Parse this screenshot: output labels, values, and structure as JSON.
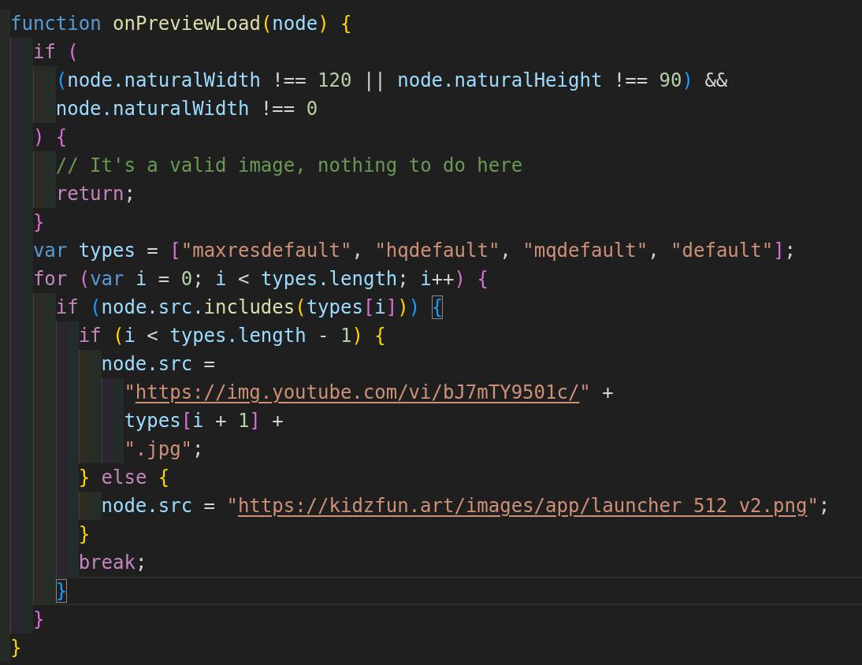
{
  "editor": {
    "lines": [
      {
        "current": false,
        "tokens": [
          {
            "kind": "kw",
            "text": "function "
          },
          {
            "kind": "fn",
            "text": "onPreviewLoad"
          },
          {
            "kind": "b1",
            "text": "("
          },
          {
            "kind": "var",
            "text": "node"
          },
          {
            "kind": "b1",
            "text": ")"
          },
          {
            "kind": "b1",
            "text": " {"
          }
        ],
        "children": [
          {
            "current": false,
            "tokens": [
              {
                "kind": "ctrl",
                "text": "if "
              },
              {
                "kind": "b2",
                "text": "("
              }
            ],
            "children": [
              {
                "current": false,
                "tokens": [
                  {
                    "kind": "b3",
                    "text": "("
                  },
                  {
                    "kind": "var",
                    "text": "node.naturalWidth"
                  },
                  {
                    "kind": "punc",
                    "text": " !== "
                  },
                  {
                    "kind": "num",
                    "text": "120"
                  },
                  {
                    "kind": "punc",
                    "text": " || "
                  },
                  {
                    "kind": "var",
                    "text": "node.naturalHeight"
                  },
                  {
                    "kind": "punc",
                    "text": " !== "
                  },
                  {
                    "kind": "num",
                    "text": "90"
                  },
                  {
                    "kind": "b3",
                    "text": ")"
                  },
                  {
                    "kind": "punc",
                    "text": " &&"
                  }
                ]
              },
              {
                "current": false,
                "tokens": [
                  {
                    "kind": "var",
                    "text": "node.naturalWidth"
                  },
                  {
                    "kind": "punc",
                    "text": " !== "
                  },
                  {
                    "kind": "num",
                    "text": "0"
                  }
                ]
              }
            ]
          },
          {
            "current": false,
            "tokens": [
              {
                "kind": "b2",
                "text": ")"
              },
              {
                "kind": "b2",
                "text": " {"
              }
            ],
            "children": [
              {
                "current": false,
                "tokens": [
                  {
                    "kind": "com",
                    "text": "// It's a valid image, nothing to do here"
                  }
                ]
              },
              {
                "current": false,
                "tokens": [
                  {
                    "kind": "ctrl",
                    "text": "return"
                  },
                  {
                    "kind": "punc",
                    "text": ";"
                  }
                ]
              }
            ]
          },
          {
            "current": false,
            "tokens": [
              {
                "kind": "b2",
                "text": "}"
              }
            ]
          },
          {
            "current": false,
            "tokens": [
              {
                "kind": "kw",
                "text": "var "
              },
              {
                "kind": "var",
                "text": "types"
              },
              {
                "kind": "punc",
                "text": " = "
              },
              {
                "kind": "b2",
                "text": "["
              },
              {
                "kind": "str",
                "text": "\"maxresdefault\""
              },
              {
                "kind": "punc",
                "text": ", "
              },
              {
                "kind": "str",
                "text": "\"hqdefault\""
              },
              {
                "kind": "punc",
                "text": ", "
              },
              {
                "kind": "str",
                "text": "\"mqdefault\""
              },
              {
                "kind": "punc",
                "text": ", "
              },
              {
                "kind": "str",
                "text": "\"default\""
              },
              {
                "kind": "b2",
                "text": "]"
              },
              {
                "kind": "punc",
                "text": ";"
              }
            ]
          },
          {
            "current": false,
            "tokens": [
              {
                "kind": "ctrl",
                "text": "for "
              },
              {
                "kind": "b2",
                "text": "("
              },
              {
                "kind": "kw",
                "text": "var "
              },
              {
                "kind": "var",
                "text": "i"
              },
              {
                "kind": "punc",
                "text": " = "
              },
              {
                "kind": "num",
                "text": "0"
              },
              {
                "kind": "punc",
                "text": "; "
              },
              {
                "kind": "var",
                "text": "i"
              },
              {
                "kind": "punc",
                "text": " < "
              },
              {
                "kind": "var",
                "text": "types.length"
              },
              {
                "kind": "punc",
                "text": "; "
              },
              {
                "kind": "var",
                "text": "i"
              },
              {
                "kind": "punc",
                "text": "++"
              },
              {
                "kind": "b2",
                "text": ")"
              },
              {
                "kind": "b2",
                "text": " {"
              }
            ],
            "children": [
              {
                "current": false,
                "tokens": [
                  {
                    "kind": "ctrl",
                    "text": "if "
                  },
                  {
                    "kind": "b3",
                    "text": "("
                  },
                  {
                    "kind": "var",
                    "text": "node.src."
                  },
                  {
                    "kind": "fn",
                    "text": "includes"
                  },
                  {
                    "kind": "b1",
                    "text": "("
                  },
                  {
                    "kind": "var",
                    "text": "types"
                  },
                  {
                    "kind": "b2",
                    "text": "["
                  },
                  {
                    "kind": "var",
                    "text": "i"
                  },
                  {
                    "kind": "b2",
                    "text": "]"
                  },
                  {
                    "kind": "b1",
                    "text": ")"
                  },
                  {
                    "kind": "b3",
                    "text": ") "
                  },
                  {
                    "kind": "b3",
                    "text": "{",
                    "matched": true
                  }
                ],
                "children": [
                  {
                    "current": false,
                    "tokens": [
                      {
                        "kind": "ctrl",
                        "text": "if "
                      },
                      {
                        "kind": "b1",
                        "text": "("
                      },
                      {
                        "kind": "var",
                        "text": "i"
                      },
                      {
                        "kind": "punc",
                        "text": " < "
                      },
                      {
                        "kind": "var",
                        "text": "types.length"
                      },
                      {
                        "kind": "punc",
                        "text": " - "
                      },
                      {
                        "kind": "num",
                        "text": "1"
                      },
                      {
                        "kind": "b1",
                        "text": ")"
                      },
                      {
                        "kind": "b1",
                        "text": " {"
                      }
                    ],
                    "children": [
                      {
                        "current": false,
                        "tokens": [
                          {
                            "kind": "var",
                            "text": "node.src"
                          },
                          {
                            "kind": "punc",
                            "text": " ="
                          }
                        ],
                        "children": [
                          {
                            "current": false,
                            "tokens": [
                              {
                                "kind": "str",
                                "text": "\""
                              },
                              {
                                "kind": "link",
                                "text": "https://img.youtube.com/vi/bJ7mTY9501c/"
                              },
                              {
                                "kind": "str",
                                "text": "\""
                              },
                              {
                                "kind": "punc",
                                "text": " +"
                              }
                            ]
                          },
                          {
                            "current": false,
                            "tokens": [
                              {
                                "kind": "var",
                                "text": "types"
                              },
                              {
                                "kind": "b2",
                                "text": "["
                              },
                              {
                                "kind": "var",
                                "text": "i"
                              },
                              {
                                "kind": "punc",
                                "text": " + "
                              },
                              {
                                "kind": "num",
                                "text": "1"
                              },
                              {
                                "kind": "b2",
                                "text": "]"
                              },
                              {
                                "kind": "punc",
                                "text": " +"
                              }
                            ]
                          },
                          {
                            "current": false,
                            "tokens": [
                              {
                                "kind": "str",
                                "text": "\".jpg\""
                              },
                              {
                                "kind": "punc",
                                "text": ";"
                              }
                            ]
                          }
                        ]
                      }
                    ]
                  },
                  {
                    "current": false,
                    "tokens": [
                      {
                        "kind": "b1",
                        "text": "} "
                      },
                      {
                        "kind": "ctrl",
                        "text": "else "
                      },
                      {
                        "kind": "b1",
                        "text": "{"
                      }
                    ],
                    "children": [
                      {
                        "current": false,
                        "tokens": [
                          {
                            "kind": "var",
                            "text": "node.src"
                          },
                          {
                            "kind": "punc",
                            "text": " = "
                          },
                          {
                            "kind": "str",
                            "text": "\""
                          },
                          {
                            "kind": "link",
                            "text": "https://kidzfun.art/images/app/launcher_512_v2.png"
                          },
                          {
                            "kind": "str",
                            "text": "\""
                          },
                          {
                            "kind": "punc",
                            "text": ";"
                          }
                        ]
                      }
                    ]
                  },
                  {
                    "current": false,
                    "tokens": [
                      {
                        "kind": "b1",
                        "text": "}"
                      }
                    ]
                  },
                  {
                    "current": false,
                    "tokens": [
                      {
                        "kind": "ctrl",
                        "text": "break"
                      },
                      {
                        "kind": "punc",
                        "text": ";"
                      }
                    ]
                  }
                ]
              },
              {
                "current": true,
                "tokens": [
                  {
                    "kind": "b3",
                    "text": "}",
                    "matched": true
                  }
                ]
              }
            ]
          },
          {
            "current": false,
            "tokens": [
              {
                "kind": "b2",
                "text": "}"
              }
            ]
          }
        ]
      },
      {
        "current": false,
        "tokens": [
          {
            "kind": "b1",
            "text": "}"
          }
        ]
      }
    ]
  }
}
